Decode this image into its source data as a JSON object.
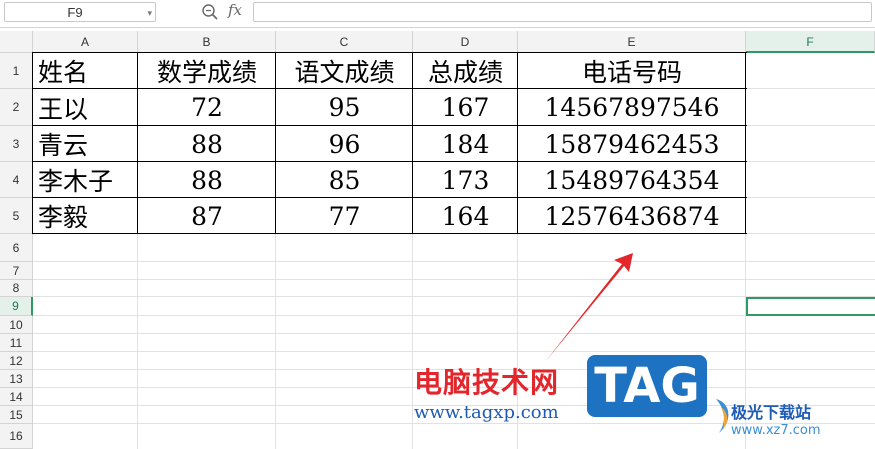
{
  "formula_bar": {
    "name_box": "F9",
    "fx_label": "fx",
    "formula_value": ""
  },
  "columns": [
    "A",
    "B",
    "C",
    "D",
    "E",
    "F"
  ],
  "rows": [
    "1",
    "2",
    "3",
    "4",
    "5",
    "6",
    "7",
    "8",
    "9",
    "10",
    "11",
    "12",
    "13",
    "14",
    "15",
    "16"
  ],
  "selected": {
    "column": "F",
    "row": "9"
  },
  "table": {
    "headers": [
      "姓名",
      "数学成绩",
      "语文成绩",
      "总成绩",
      "电话号码"
    ],
    "rows": [
      [
        "王以",
        "72",
        "95",
        "167",
        "14567897546"
      ],
      [
        "青云",
        "88",
        "96",
        "184",
        "15879462453"
      ],
      [
        "李木子",
        "88",
        "85",
        "173",
        "15489764354"
      ],
      [
        "李毅",
        "87",
        "77",
        "164",
        "12576436874"
      ]
    ]
  },
  "watermark": {
    "site_name": "电脑技术网",
    "site_url": "www.tagxp.com",
    "tag_label": "TAG",
    "logo_name": "极光下载站",
    "logo_url": "www.xz7.com",
    "arrow_color": "#e3262c",
    "tag_color": "#1e72c2"
  },
  "colors": {
    "selection": "#2e9a62",
    "header_bg": "#f3f3f3",
    "gridline": "#e1e1e1"
  }
}
